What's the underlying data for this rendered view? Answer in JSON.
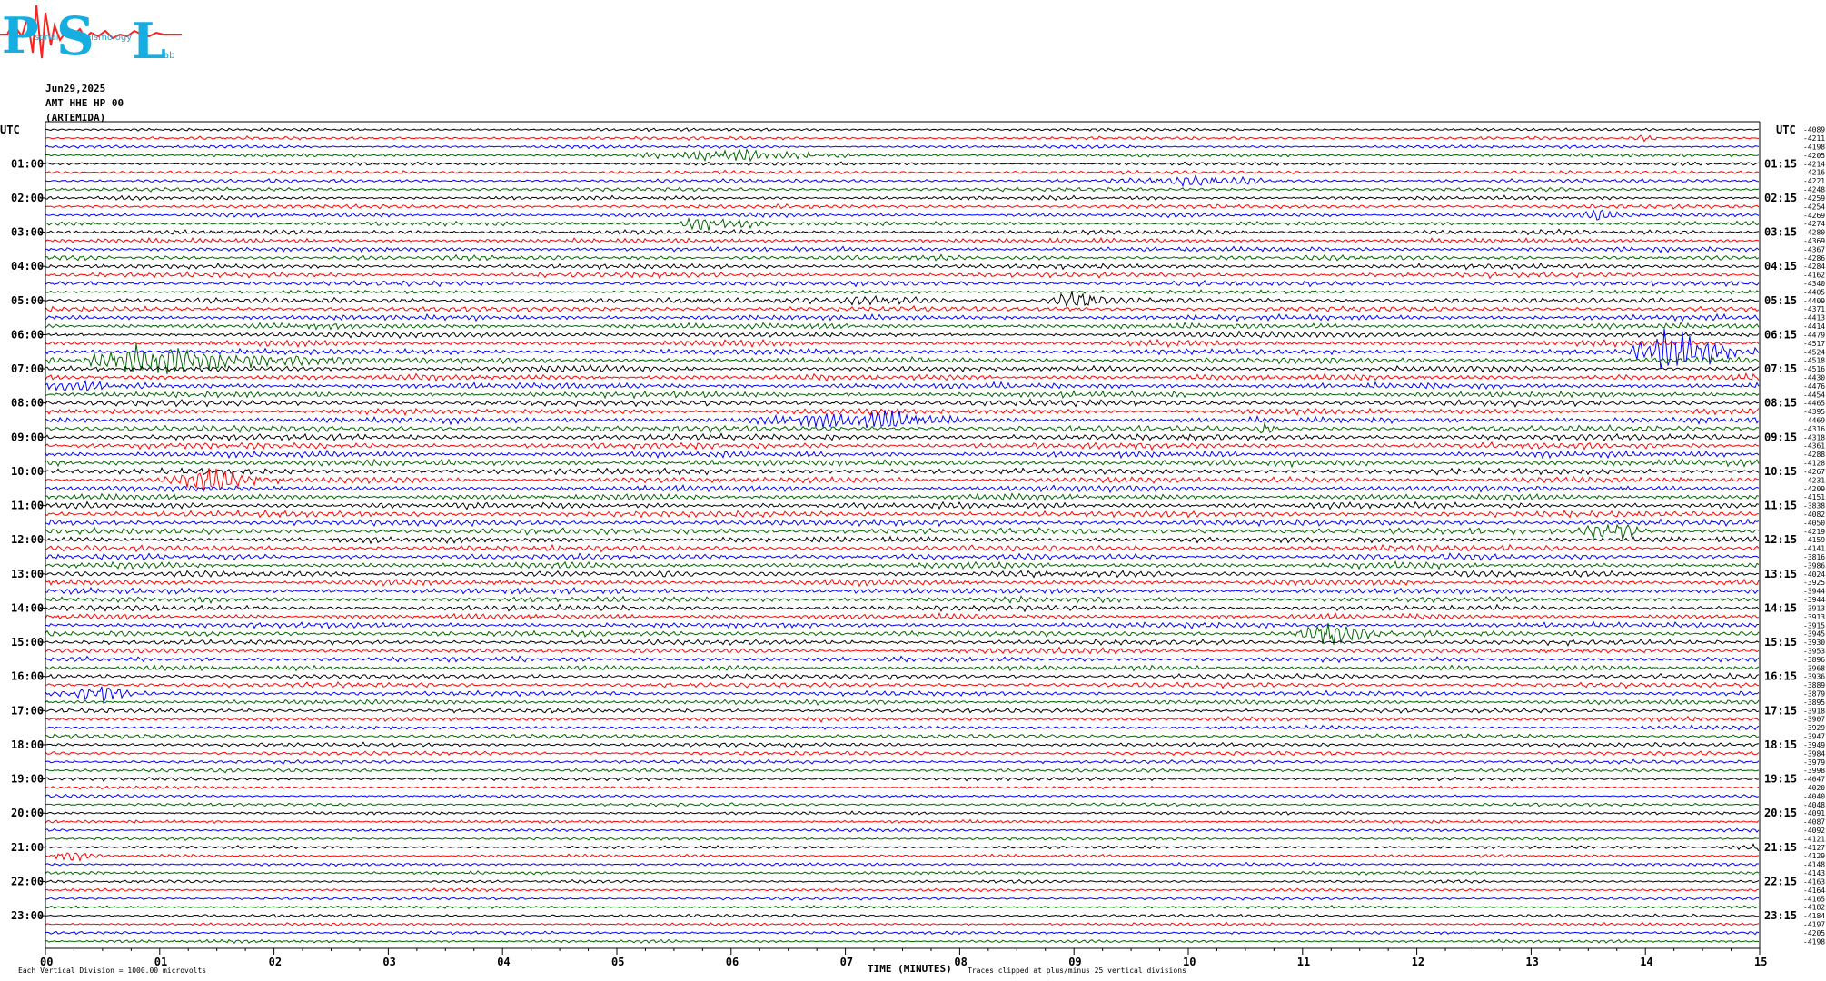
{
  "logo": {
    "letters": [
      "P",
      "S",
      "L"
    ],
    "small_text": [
      "sonal",
      "eismology",
      "ab"
    ]
  },
  "header": {
    "date": "Jun29,2025",
    "station": "AMT HHE HP 00",
    "name": "(ARTEMIDA)"
  },
  "axis": {
    "left_utc": "UTC",
    "right_utc": "UTC",
    "xlabel": "TIME (MINUTES)",
    "footer_left": "Each Vertical Division = 1000.00 microvolts",
    "footer_right": "Traces clipped at plus/minus 25 vertical divisions"
  },
  "colors": {
    "trace_cycle": [
      "#000000",
      "#ff0000",
      "#0000ff",
      "#006400"
    ],
    "frame": "#000000"
  },
  "chart_data": {
    "type": "line",
    "title": "",
    "xlabel": "TIME (MINUTES)",
    "ylabel": "",
    "xlim": [
      0,
      15
    ],
    "x_ticks": [
      "00",
      "01",
      "02",
      "03",
      "04",
      "05",
      "06",
      "07",
      "08",
      "09",
      "10",
      "11",
      "12",
      "13",
      "14",
      "15"
    ],
    "left_hour_labels": [
      "01:00",
      "02:00",
      "03:00",
      "04:00",
      "05:00",
      "06:00",
      "07:00",
      "08:00",
      "09:00",
      "10:00",
      "11:00",
      "12:00",
      "13:00",
      "14:00",
      "15:00",
      "16:00",
      "17:00",
      "18:00",
      "19:00",
      "20:00",
      "21:00",
      "22:00",
      "23:00"
    ],
    "right_hour_labels": [
      "01:15",
      "02:15",
      "03:15",
      "04:15",
      "05:15",
      "06:15",
      "07:15",
      "08:15",
      "09:15",
      "10:15",
      "11:15",
      "12:15",
      "13:15",
      "14:15",
      "15:15",
      "16:15",
      "17:15",
      "18:15",
      "19:15",
      "20:15",
      "21:15",
      "22:15",
      "23:15"
    ],
    "trace_count": 96,
    "trace_minutes": 15,
    "trace_offsets": [
      "-4089",
      "-4211",
      "-4198",
      "-4205",
      "-4214",
      "-4216",
      "-4221",
      "-4248",
      "-4259",
      "-4254",
      "-4269",
      "-4274",
      "-4280",
      "-4369",
      "-4367",
      "-4286",
      "-4284",
      "-4162",
      "-4340",
      "-4405",
      "-4409",
      "-4371",
      "-4413",
      "-4414",
      "-4479",
      "-4517",
      "-4524",
      "-4518",
      "-4516",
      "-4430",
      "-4476",
      "-4454",
      "-4465",
      "-4395",
      "-4469",
      "-4316",
      "-4318",
      "-4361",
      "-4288",
      "-4128",
      "-4267",
      "-4231",
      "-4209",
      "-4151",
      "-3838",
      "-4082",
      "-4050",
      "-4219",
      "-4159",
      "-4141",
      "-3816",
      "-3986",
      "-4024",
      "-3925",
      "-3944",
      "-3944",
      "-3913",
      "-3913",
      "-3915",
      "-3945",
      "-3930",
      "-3953",
      "-3896",
      "-3968",
      "-3936",
      "-3889",
      "-3879",
      "-3895",
      "-3918",
      "-3907",
      "-3929",
      "-3947",
      "-3949",
      "-3984",
      "-3979",
      "-3998",
      "-4047",
      "-4020",
      "-4040",
      "-4048",
      "-4091",
      "-4087",
      "-4092",
      "-4121",
      "-4127",
      "-4129",
      "-4148",
      "-4143",
      "-4163",
      "-4164",
      "-4165",
      "-4182",
      "-4184",
      "-4197",
      "-4205",
      "-4198"
    ],
    "events": [
      {
        "trace": 3,
        "start_min": 5.0,
        "peak_min": 6.05,
        "end_min": 7.9,
        "amp": 1.4
      },
      {
        "trace": 6,
        "start_min": 9.2,
        "peak_min": 10.3,
        "end_min": 11.0,
        "amp": 1.1
      },
      {
        "trace": 1,
        "start_min": 13.9,
        "peak_min": 14.0,
        "end_min": 14.2,
        "amp": 1.0
      },
      {
        "trace": 10,
        "start_min": 13.4,
        "peak_min": 13.6,
        "end_min": 13.9,
        "amp": 1.0
      },
      {
        "trace": 11,
        "start_min": 5.5,
        "peak_min": 5.8,
        "end_min": 6.4,
        "amp": 3.5
      },
      {
        "trace": 20,
        "start_min": 6.5,
        "peak_min": 7.5,
        "end_min": 8.2,
        "amp": 1.2
      },
      {
        "trace": 20,
        "start_min": 8.7,
        "peak_min": 9.1,
        "end_min": 9.5,
        "amp": 1.5
      },
      {
        "trace": 27,
        "start_min": 0.3,
        "peak_min": 1.1,
        "end_min": 2.8,
        "amp": 5.0
      },
      {
        "trace": 26,
        "start_min": 13.8,
        "peak_min": 14.3,
        "end_min": 15.0,
        "amp": 4.0
      },
      {
        "trace": 30,
        "start_min": 0.0,
        "peak_min": 0.2,
        "end_min": 0.6,
        "amp": 1.2
      },
      {
        "trace": 34,
        "start_min": 5.8,
        "peak_min": 7.5,
        "end_min": 8.3,
        "amp": 1.2
      },
      {
        "trace": 35,
        "start_min": 10.6,
        "peak_min": 10.7,
        "end_min": 10.8,
        "amp": 1.6
      },
      {
        "trace": 41,
        "start_min": 1.0,
        "peak_min": 1.5,
        "end_min": 2.2,
        "amp": 2.0
      },
      {
        "trace": 47,
        "start_min": 13.3,
        "peak_min": 13.8,
        "end_min": 14.1,
        "amp": 2.0
      },
      {
        "trace": 59,
        "start_min": 10.9,
        "peak_min": 11.15,
        "end_min": 11.8,
        "amp": 3.5
      },
      {
        "trace": 66,
        "start_min": 0.1,
        "peak_min": 0.6,
        "end_min": 0.9,
        "amp": 1.5
      },
      {
        "trace": 85,
        "start_min": 0.0,
        "peak_min": 0.2,
        "end_min": 0.6,
        "amp": 2.0
      },
      {
        "trace": 84,
        "start_min": 14.6,
        "peak_min": 15.0,
        "end_min": 15.0,
        "amp": 1.8
      }
    ]
  }
}
